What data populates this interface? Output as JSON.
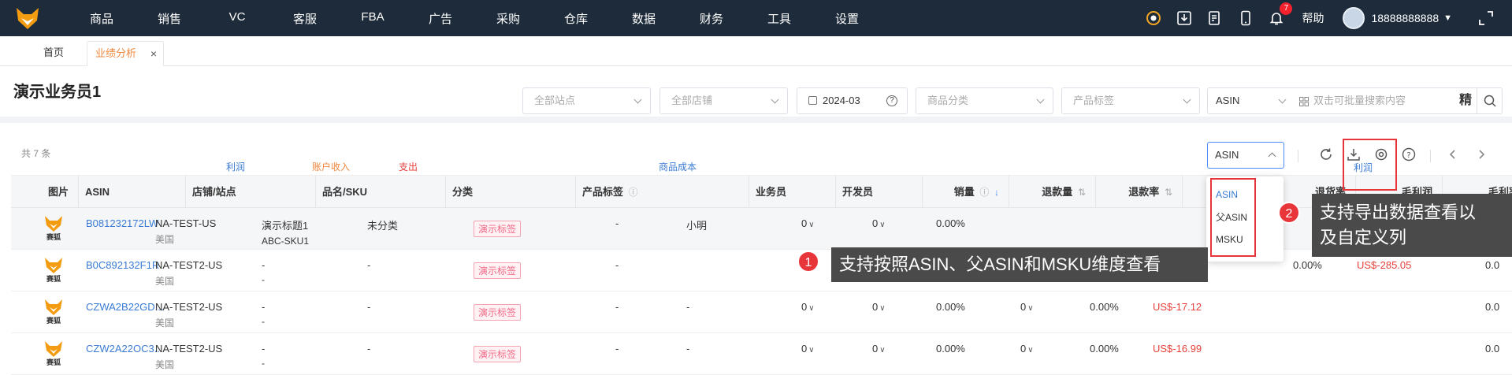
{
  "nav": {
    "items": [
      "商品",
      "销售",
      "VC",
      "客服",
      "FBA",
      "广告",
      "采购",
      "仓库",
      "数据",
      "财务",
      "工具",
      "设置"
    ],
    "badge": "7",
    "help": "帮助",
    "user": "18888888888"
  },
  "tabs": {
    "home": "首页",
    "active": "业绩分析",
    "close": "×"
  },
  "page": {
    "title": "演示业务员1"
  },
  "filters": {
    "site": "全部站点",
    "store": "全部店铺",
    "month": "2024-03",
    "category": "商品分类",
    "tag": "产品标签",
    "search_type": "ASIN",
    "search_placeholder": "双击可批量搜索内容",
    "precise": "精"
  },
  "toolbar": {
    "total": "共 7 条",
    "sum_labels": [
      "利润",
      "账户收入",
      "支出",
      "商品成本",
      "利润"
    ],
    "dimension_select": "ASIN"
  },
  "dropdown": {
    "options": [
      "ASIN",
      "父ASIN",
      "MSKU"
    ],
    "selected": "ASIN"
  },
  "table": {
    "headers": {
      "image": "图片",
      "asin": "ASIN",
      "store": "店铺/站点",
      "sku": "品名/SKU",
      "category": "分类",
      "tag": "产品标签",
      "salesman": "业务员",
      "developer": "开发员",
      "sales": "销量",
      "refunds": "退款量",
      "refund_rate": "退款率",
      "return_rate": "退货率",
      "gross_profit": "毛利润",
      "gross_margin": "毛利率"
    },
    "thumb_label": "赛狐",
    "rows": [
      {
        "asin": "B081232172LW",
        "store": "NA-TEST-US",
        "country": "美国",
        "name": "演示标题1",
        "sku": "ABC-SKU1",
        "category": "未分类",
        "tag": "演示标签",
        "salesman": "-",
        "developer": "小明",
        "sales": "0",
        "refunds": "0",
        "refund_rate": "0.00%",
        "return_rate": "",
        "gross_profit": "",
        "gross_margin": ""
      },
      {
        "asin": "B0C892132F1R",
        "store": "NA-TEST2-US",
        "country": "美国",
        "name": "-",
        "sku": "-",
        "category": "-",
        "tag": "演示标签",
        "salesman": "-",
        "developer": "",
        "sales": "",
        "refunds": "",
        "refund_rate": "",
        "return_rate": "0.00%",
        "gross_profit": "US$-285.05",
        "gross_margin": "0.0"
      },
      {
        "asin": "CZWA2B22GD...",
        "store": "NA-TEST2-US",
        "country": "美国",
        "name": "-",
        "sku": "-",
        "category": "-",
        "tag": "演示标签",
        "salesman": "-",
        "developer": "-",
        "sales": "0",
        "refunds": "0",
        "refund_rate": "0.00%",
        "col_extra": "0",
        "return_rate": "0.00%",
        "gross_profit": "US$-17.12",
        "gross_margin": "0.0"
      },
      {
        "asin": "CZW2A22OC3...",
        "store": "NA-TEST2-US",
        "country": "美国",
        "name": "-",
        "sku": "-",
        "category": "-",
        "tag": "演示标签",
        "salesman": "-",
        "developer": "-",
        "sales": "0",
        "refunds": "0",
        "refund_rate": "0.00%",
        "col_extra": "0",
        "return_rate": "0.00%",
        "gross_profit": "US$-16.99",
        "gross_margin": "0.0"
      }
    ]
  },
  "callouts": {
    "one_num": "1",
    "one": "支持按照ASIN、父ASIN和MSKU维度查看",
    "two_num": "2",
    "two_line1": "支持导出数据查看以",
    "two_line2": "及自定义列"
  },
  "colors": {
    "nav_bg": "#1e2b3a",
    "accent": "#f0883e",
    "link": "#3a7bd5",
    "red": "#e8353a"
  }
}
